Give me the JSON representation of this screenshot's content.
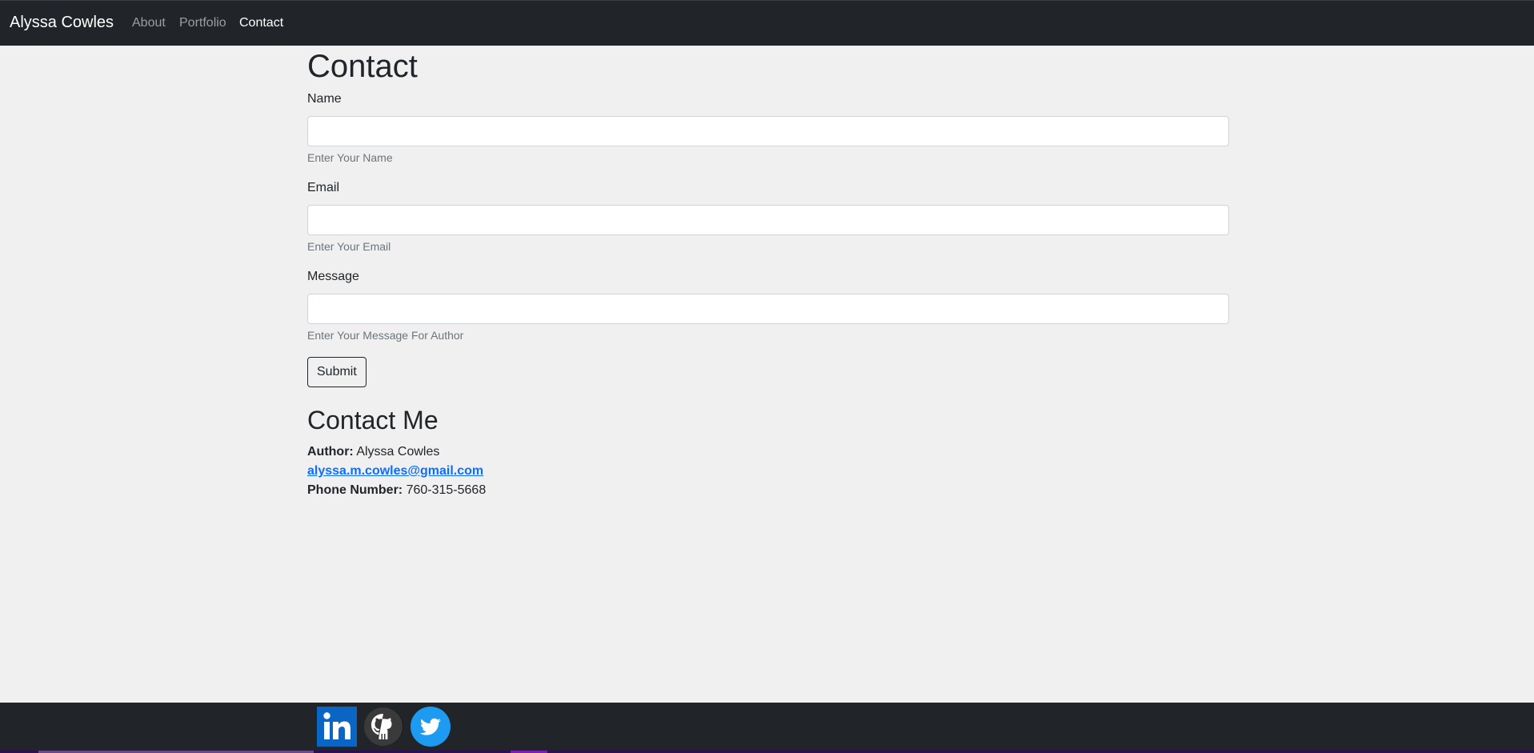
{
  "navbar": {
    "brand": "Alyssa Cowles",
    "links": [
      {
        "label": "About",
        "active": false
      },
      {
        "label": "Portfolio",
        "active": false
      },
      {
        "label": "Contact",
        "active": true
      }
    ]
  },
  "contact_form": {
    "title": "Contact",
    "fields": [
      {
        "label": "Name",
        "value": "",
        "help": "Enter Your Name"
      },
      {
        "label": "Email",
        "value": "",
        "help": "Enter Your Email"
      },
      {
        "label": "Message",
        "value": "",
        "help": "Enter Your Message For Author"
      }
    ],
    "submit_label": "Submit"
  },
  "contact_me": {
    "title": "Contact Me",
    "author_label": "Author:",
    "author_name": "Alyssa Cowles",
    "email": "alyssa.m.cowles@gmail.com",
    "phone_label": "Phone Number:",
    "phone": "760-315-5668"
  },
  "footer": {
    "social": [
      {
        "icon": "linkedin-icon",
        "color": "#0a66c2"
      },
      {
        "icon": "github-icon",
        "color": "#333333"
      },
      {
        "icon": "twitter-icon",
        "color": "#1d9bf0"
      }
    ]
  },
  "colors": {
    "navbar_bg": "#212529",
    "page_bg": "#f0f0f0",
    "link": "#0d6efd"
  }
}
